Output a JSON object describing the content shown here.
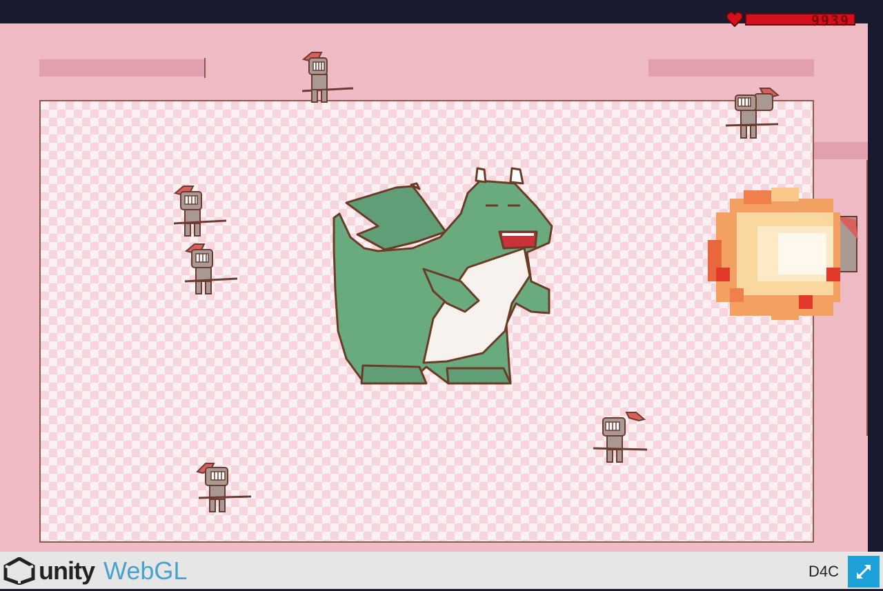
{
  "game": {
    "hud": {
      "hp_value": "9939",
      "hp_fill": 1.0,
      "heart_icon": "heart-icon"
    },
    "entities": [
      "dragon",
      "knight",
      "fireball"
    ],
    "colors": {
      "wall": "#efbcc6",
      "floor": "#fdf0f2",
      "hp": "#d60f1d",
      "dragon": "#69ad82"
    }
  },
  "footer": {
    "brand_name": "unity",
    "brand_product": "WebGL",
    "game_title": "D4C",
    "fullscreen_icon": "fullscreen-icon"
  }
}
